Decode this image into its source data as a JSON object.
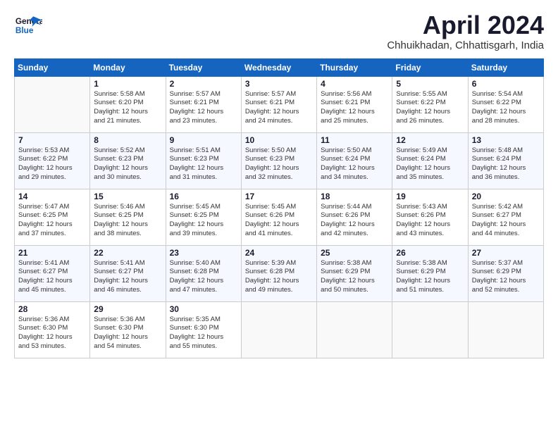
{
  "header": {
    "logo_line1": "General",
    "logo_line2": "Blue",
    "month_title": "April 2024",
    "location": "Chhuikhadan, Chhattisgarh, India"
  },
  "weekdays": [
    "Sunday",
    "Monday",
    "Tuesday",
    "Wednesday",
    "Thursday",
    "Friday",
    "Saturday"
  ],
  "weeks": [
    [
      {
        "day": "",
        "info": ""
      },
      {
        "day": "1",
        "info": "Sunrise: 5:58 AM\nSunset: 6:20 PM\nDaylight: 12 hours\nand 21 minutes."
      },
      {
        "day": "2",
        "info": "Sunrise: 5:57 AM\nSunset: 6:21 PM\nDaylight: 12 hours\nand 23 minutes."
      },
      {
        "day": "3",
        "info": "Sunrise: 5:57 AM\nSunset: 6:21 PM\nDaylight: 12 hours\nand 24 minutes."
      },
      {
        "day": "4",
        "info": "Sunrise: 5:56 AM\nSunset: 6:21 PM\nDaylight: 12 hours\nand 25 minutes."
      },
      {
        "day": "5",
        "info": "Sunrise: 5:55 AM\nSunset: 6:22 PM\nDaylight: 12 hours\nand 26 minutes."
      },
      {
        "day": "6",
        "info": "Sunrise: 5:54 AM\nSunset: 6:22 PM\nDaylight: 12 hours\nand 28 minutes."
      }
    ],
    [
      {
        "day": "7",
        "info": "Sunrise: 5:53 AM\nSunset: 6:22 PM\nDaylight: 12 hours\nand 29 minutes."
      },
      {
        "day": "8",
        "info": "Sunrise: 5:52 AM\nSunset: 6:23 PM\nDaylight: 12 hours\nand 30 minutes."
      },
      {
        "day": "9",
        "info": "Sunrise: 5:51 AM\nSunset: 6:23 PM\nDaylight: 12 hours\nand 31 minutes."
      },
      {
        "day": "10",
        "info": "Sunrise: 5:50 AM\nSunset: 6:23 PM\nDaylight: 12 hours\nand 32 minutes."
      },
      {
        "day": "11",
        "info": "Sunrise: 5:50 AM\nSunset: 6:24 PM\nDaylight: 12 hours\nand 34 minutes."
      },
      {
        "day": "12",
        "info": "Sunrise: 5:49 AM\nSunset: 6:24 PM\nDaylight: 12 hours\nand 35 minutes."
      },
      {
        "day": "13",
        "info": "Sunrise: 5:48 AM\nSunset: 6:24 PM\nDaylight: 12 hours\nand 36 minutes."
      }
    ],
    [
      {
        "day": "14",
        "info": "Sunrise: 5:47 AM\nSunset: 6:25 PM\nDaylight: 12 hours\nand 37 minutes."
      },
      {
        "day": "15",
        "info": "Sunrise: 5:46 AM\nSunset: 6:25 PM\nDaylight: 12 hours\nand 38 minutes."
      },
      {
        "day": "16",
        "info": "Sunrise: 5:45 AM\nSunset: 6:25 PM\nDaylight: 12 hours\nand 39 minutes."
      },
      {
        "day": "17",
        "info": "Sunrise: 5:45 AM\nSunset: 6:26 PM\nDaylight: 12 hours\nand 41 minutes."
      },
      {
        "day": "18",
        "info": "Sunrise: 5:44 AM\nSunset: 6:26 PM\nDaylight: 12 hours\nand 42 minutes."
      },
      {
        "day": "19",
        "info": "Sunrise: 5:43 AM\nSunset: 6:26 PM\nDaylight: 12 hours\nand 43 minutes."
      },
      {
        "day": "20",
        "info": "Sunrise: 5:42 AM\nSunset: 6:27 PM\nDaylight: 12 hours\nand 44 minutes."
      }
    ],
    [
      {
        "day": "21",
        "info": "Sunrise: 5:41 AM\nSunset: 6:27 PM\nDaylight: 12 hours\nand 45 minutes."
      },
      {
        "day": "22",
        "info": "Sunrise: 5:41 AM\nSunset: 6:27 PM\nDaylight: 12 hours\nand 46 minutes."
      },
      {
        "day": "23",
        "info": "Sunrise: 5:40 AM\nSunset: 6:28 PM\nDaylight: 12 hours\nand 47 minutes."
      },
      {
        "day": "24",
        "info": "Sunrise: 5:39 AM\nSunset: 6:28 PM\nDaylight: 12 hours\nand 49 minutes."
      },
      {
        "day": "25",
        "info": "Sunrise: 5:38 AM\nSunset: 6:29 PM\nDaylight: 12 hours\nand 50 minutes."
      },
      {
        "day": "26",
        "info": "Sunrise: 5:38 AM\nSunset: 6:29 PM\nDaylight: 12 hours\nand 51 minutes."
      },
      {
        "day": "27",
        "info": "Sunrise: 5:37 AM\nSunset: 6:29 PM\nDaylight: 12 hours\nand 52 minutes."
      }
    ],
    [
      {
        "day": "28",
        "info": "Sunrise: 5:36 AM\nSunset: 6:30 PM\nDaylight: 12 hours\nand 53 minutes."
      },
      {
        "day": "29",
        "info": "Sunrise: 5:36 AM\nSunset: 6:30 PM\nDaylight: 12 hours\nand 54 minutes."
      },
      {
        "day": "30",
        "info": "Sunrise: 5:35 AM\nSunset: 6:30 PM\nDaylight: 12 hours\nand 55 minutes."
      },
      {
        "day": "",
        "info": ""
      },
      {
        "day": "",
        "info": ""
      },
      {
        "day": "",
        "info": ""
      },
      {
        "day": "",
        "info": ""
      }
    ]
  ]
}
